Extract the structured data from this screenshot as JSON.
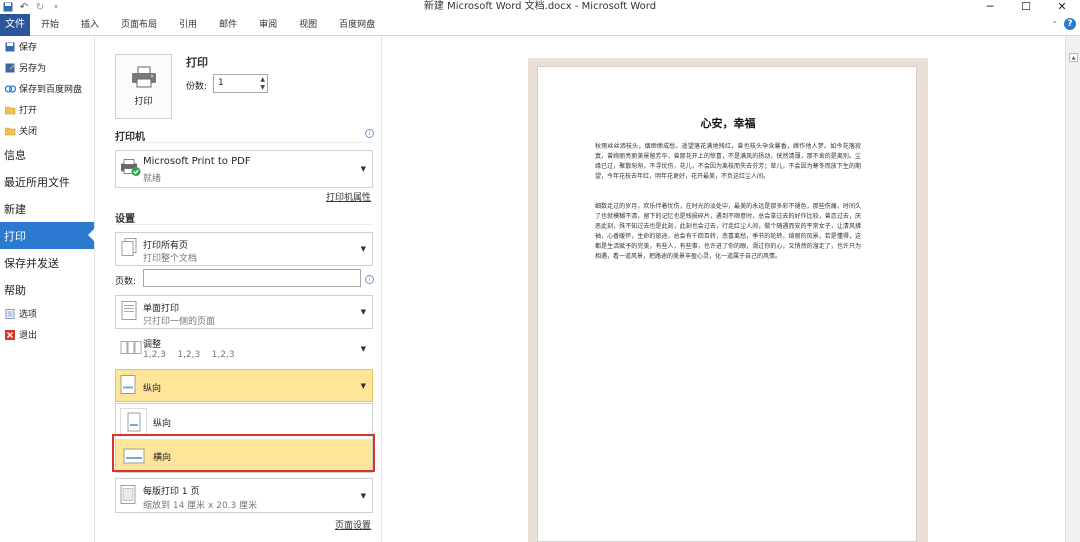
{
  "titlebar": {
    "title": "新建 Microsoft Word 文档.docx - Microsoft Word",
    "controls": [
      "─",
      "☐",
      "✕"
    ]
  },
  "ribbon": {
    "tabs": [
      "文件",
      "开始",
      "插入",
      "页面布局",
      "引用",
      "邮件",
      "审阅",
      "视图",
      "百度网盘"
    ]
  },
  "nav": {
    "save": "保存",
    "save_as": "另存为",
    "save_baidu": "保存到百度网盘",
    "open": "打开",
    "close": "关闭",
    "info": "信息",
    "recent": "最近所用文件",
    "new": "新建",
    "print": "打印",
    "save_send": "保存并发送",
    "help": "帮助",
    "options": "选项",
    "exit": "退出"
  },
  "print": {
    "button_label": "打印",
    "title": "打印",
    "copies_label": "份数:",
    "copies_value": "1"
  },
  "printer": {
    "section": "打印机",
    "name": "Microsoft Print to PDF",
    "status": "就绪",
    "properties_link": "打印机属性"
  },
  "settings": {
    "section": "设置",
    "range_main": "打印所有页",
    "range_sub": "打印整个文档",
    "pages_label": "页数:",
    "sides_main": "单面打印",
    "sides_sub": "只打印一侧的页面",
    "collate_main": "调整",
    "collate_sub": "1,2,3    1,2,3    1,2,3",
    "orientation_main": "纵向",
    "orientation_options": [
      "纵向",
      "横向"
    ],
    "perpage_main": "每版打印 1 页",
    "perpage_sub": "缩放到 14 厘米 x 20.3 厘米",
    "page_setup_link": "页面设置"
  },
  "document": {
    "title": "心安，幸福",
    "p1": "秋雨丝丝洒枝头，烟缈缈成愁。遥望落花满地残红，曾也枝头孕含馨香，嫁作他人梦。如今花落寂寞，曾绚丽亮丽美景留芳华，曾那花开上的惊喜，不是满风的扬动，恍然清薄，那不舍的是离别。尘缘已过，聚散匆匆，不寻忧伤，花儿，不会因为离枝而失去芬芳；草儿，不会因为寒冬而放下生的期望，今年花枝去年红，明年花更好，花开最美，不负这红尘人间。",
    "p2": "细数走过的岁月，欢乐伴着忧伤，在时光的淡处中，最美的永远是那多彩不褪色，那些伤痛，时间久了也就模糊不清，留下的记忆也是残损碎片，遇到不顺意时，总会拿过去的好作比较，曾恋过去，厌恶此刻，殊不知过去也是此刻，此刻也会过去，行走红尘人间，做个随遇而安的平常女子，让清风拂袖，心香暖怀，生命的旅途，总会有千回百转，悲喜离愁，季节的轮转，绮丽的风景，若是懂得，这都是生活赋予的完美，有些人，有些事，也许进了你的眼，滑过你的心，又悄然的溜走了，也许只为相遇，看一道风景，把路途的美景丰盈心灵，化一道属于自己的风情。"
  }
}
